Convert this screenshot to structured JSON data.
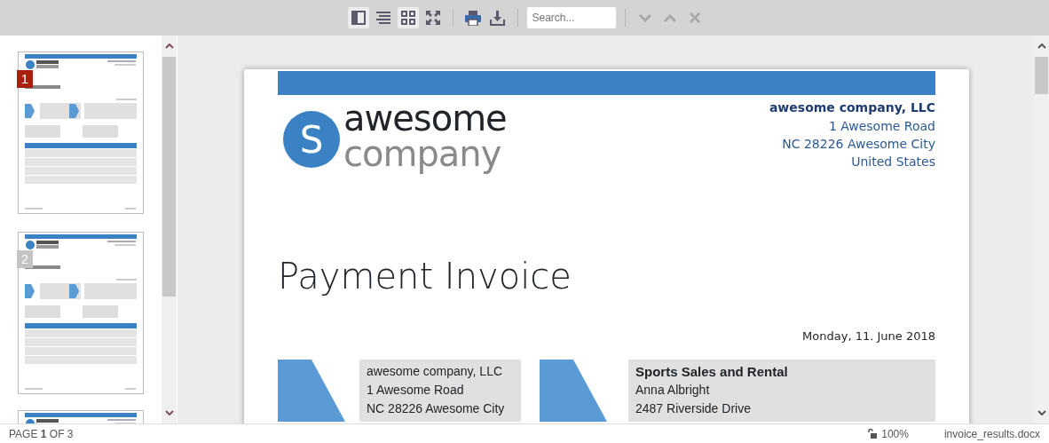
{
  "toolbar": {
    "view_buttons": [
      {
        "kind": "sidebar",
        "selected": true
      },
      {
        "kind": "continuous",
        "selected": false
      },
      {
        "kind": "multipage",
        "selected": true
      },
      {
        "kind": "fullscreen",
        "selected": false
      }
    ],
    "action_buttons": [
      {
        "kind": "print"
      },
      {
        "kind": "download"
      }
    ],
    "search": {
      "placeholder": "Search..."
    },
    "nav_buttons": [
      {
        "kind": "next",
        "disabled": true
      },
      {
        "kind": "previous",
        "disabled": true
      },
      {
        "kind": "close",
        "disabled": true
      }
    ]
  },
  "sidebar": {
    "thumbnails": [
      {
        "number": "1",
        "selected": true
      },
      {
        "number": "2",
        "selected": false
      },
      {
        "selected": false
      }
    ]
  },
  "document": {
    "company": {
      "name": "awesome company, LLC",
      "lines": [
        "1 Awesome Road",
        "NC 28226 Awesome City",
        "United States"
      ]
    },
    "logo": {
      "mark": "S",
      "word_1": "awesome",
      "word_2": "company"
    },
    "title": "Payment Invoice",
    "date": "Monday, 11. June 2018",
    "sender": [
      "awesome company, LLC",
      "1 Awesome Road",
      "NC 28226 Awesome City"
    ],
    "recipient": {
      "name": "Sports Sales and Rental",
      "lines": [
        "Anna Albright",
        "2487 Riverside Drive"
      ]
    }
  },
  "status_bar": {
    "page": "PAGE **1** OF 3",
    "zoom": "100%",
    "file": "invoice_results.docx"
  }
}
